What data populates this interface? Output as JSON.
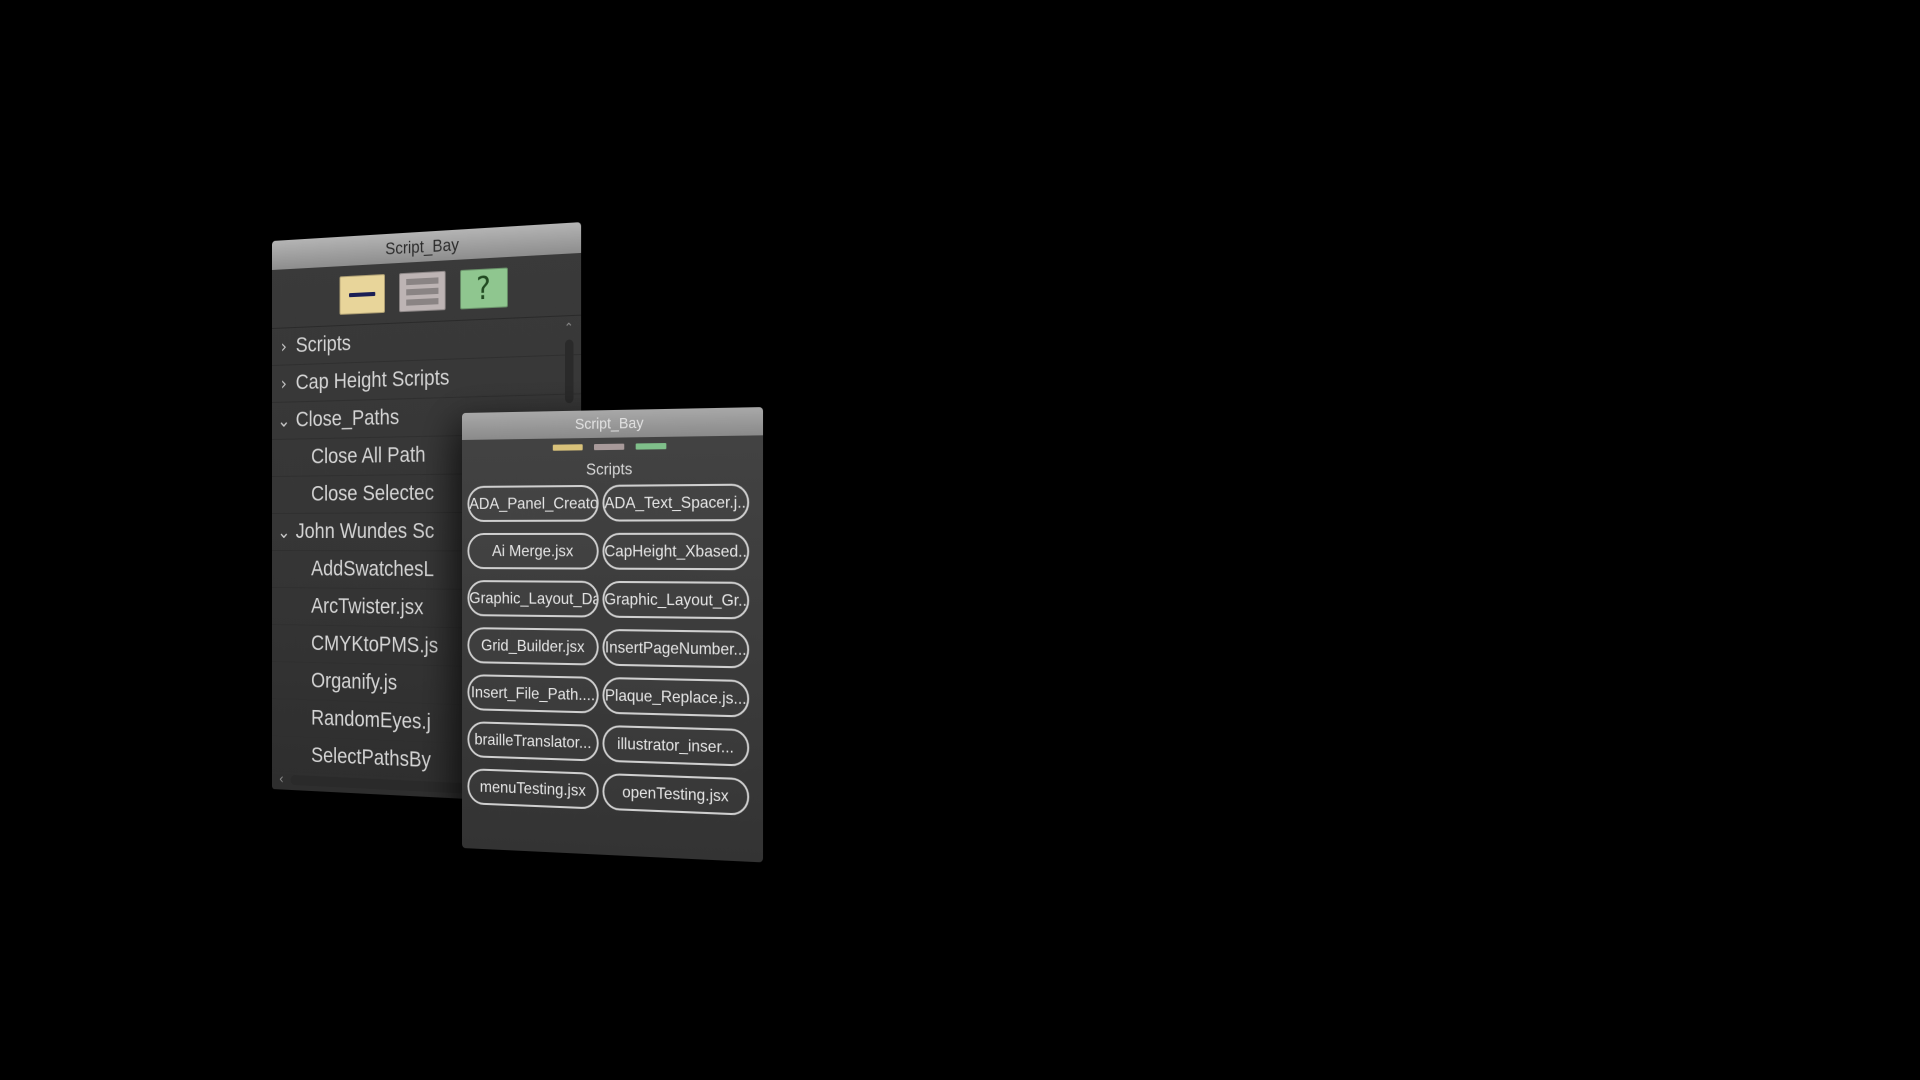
{
  "back_panel": {
    "title": "Script_Bay",
    "toolbar": {
      "collapse_icon": "collapse-all-icon",
      "expand_icon": "expand-all-icon",
      "help_label": "?",
      "colors": {
        "collapse": "#e8d59a",
        "expand": "#bdb4b4",
        "help": "#8fc68f"
      }
    },
    "tree": [
      {
        "label": "Scripts",
        "state": "collapsed",
        "chevron": "›"
      },
      {
        "label": "Cap Height Scripts",
        "state": "collapsed",
        "chevron": "›"
      },
      {
        "label": "Close_Paths",
        "state": "expanded",
        "chevron": "⌄"
      },
      {
        "label": "Close All Path",
        "child": true
      },
      {
        "label": "Close Selectec",
        "child": true
      },
      {
        "label": "John Wundes Sc",
        "state": "expanded",
        "chevron": "⌄"
      },
      {
        "label": "AddSwatchesL",
        "child": true
      },
      {
        "label": "ArcTwister.jsx",
        "child": true
      },
      {
        "label": "CMYKtoPMS.js",
        "child": true
      },
      {
        "label": "Organify.js",
        "child": true
      },
      {
        "label": "RandomEyes.j",
        "child": true
      },
      {
        "label": "SelectPathsBy",
        "child": true
      }
    ],
    "scroll": {
      "up": "⌃",
      "left": "‹"
    }
  },
  "front_panel": {
    "title": "Script_Bay",
    "swatches": [
      "#d9c27a",
      "#a89a9a",
      "#7fbf8a"
    ],
    "section_title": "Scripts",
    "buttons": [
      "ADA_Panel_Creator...",
      "ADA_Text_Spacer.j...",
      "Ai Merge.jsx",
      "CapHeight_Xbased...",
      "Graphic_Layout_Da...",
      "Graphic_Layout_Gr...",
      "Grid_Builder.jsx",
      "InsertPageNumber...",
      "Insert_File_Path....",
      "Plaque_Replace.js...",
      "brailleTranslator...",
      "illustrator_inser...",
      "menuTesting.jsx",
      "openTesting.jsx"
    ]
  }
}
